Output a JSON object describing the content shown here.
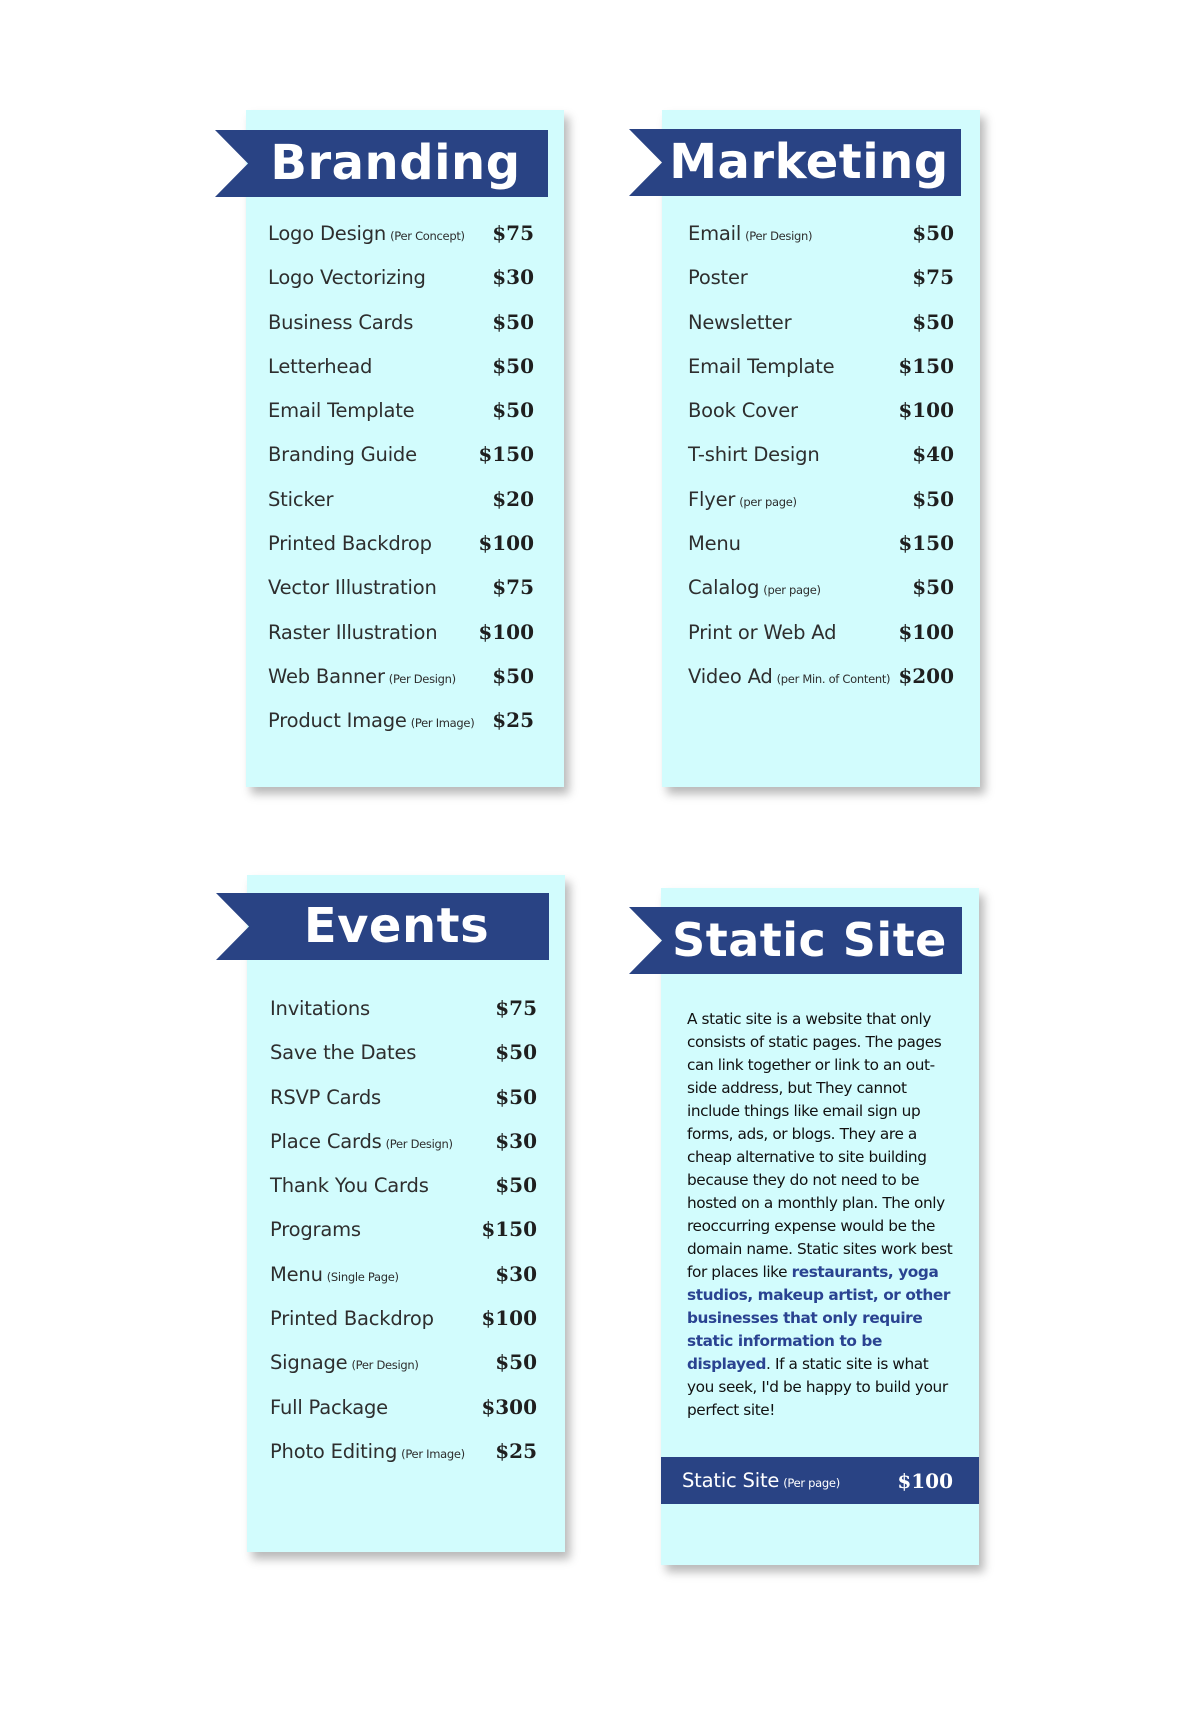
{
  "branding": {
    "title": "Branding",
    "items": [
      {
        "name": "Logo Design",
        "note": "(Per Concept)",
        "price": "$75"
      },
      {
        "name": "Logo Vectorizing",
        "note": "",
        "price": "$30"
      },
      {
        "name": "Business Cards",
        "note": "",
        "price": "$50"
      },
      {
        "name": "Letterhead",
        "note": "",
        "price": "$50"
      },
      {
        "name": "Email Template",
        "note": "",
        "price": "$50"
      },
      {
        "name": "Branding Guide",
        "note": "",
        "price": "$150"
      },
      {
        "name": "Sticker",
        "note": "",
        "price": "$20"
      },
      {
        "name": "Printed Backdrop",
        "note": "",
        "price": "$100"
      },
      {
        "name": "Vector Illustration",
        "note": "",
        "price": "$75"
      },
      {
        "name": "Raster Illustration",
        "note": "",
        "price": "$100"
      },
      {
        "name": "Web Banner",
        "note": "(Per Design)",
        "price": "$50"
      },
      {
        "name": "Product Image",
        "note": "(Per Image)",
        "price": "$25"
      }
    ]
  },
  "marketing": {
    "title": "Marketing",
    "items": [
      {
        "name": "Email",
        "note": "(Per Design)",
        "price": "$50"
      },
      {
        "name": "Poster",
        "note": "",
        "price": "$75"
      },
      {
        "name": "Newsletter",
        "note": "",
        "price": "$50"
      },
      {
        "name": "Email Template",
        "note": "",
        "price": "$150"
      },
      {
        "name": "Book Cover",
        "note": "",
        "price": "$100"
      },
      {
        "name": "T-shirt Design",
        "note": "",
        "price": "$40"
      },
      {
        "name": "Flyer",
        "note": "(per page)",
        "price": "$50"
      },
      {
        "name": "Menu",
        "note": "",
        "price": "$150"
      },
      {
        "name": "Calalog",
        "note": "(per page)",
        "price": "$50"
      },
      {
        "name": "Print or Web Ad",
        "note": "",
        "price": "$100"
      },
      {
        "name": "Video Ad",
        "note": "(per Min. of Content)",
        "price": "$200"
      }
    ]
  },
  "events": {
    "title": "Events",
    "items": [
      {
        "name": "Invitations",
        "note": "",
        "price": "$75"
      },
      {
        "name": "Save the Dates",
        "note": "",
        "price": "$50"
      },
      {
        "name": "RSVP Cards",
        "note": "",
        "price": "$50"
      },
      {
        "name": "Place Cards",
        "note": "(Per Design)",
        "price": "$30"
      },
      {
        "name": "Thank You Cards",
        "note": "",
        "price": "$50"
      },
      {
        "name": "Programs",
        "note": "",
        "price": "$150"
      },
      {
        "name": "Menu",
        "note": "(Single Page)",
        "price": "$30"
      },
      {
        "name": "Printed Backdrop",
        "note": "",
        "price": "$100"
      },
      {
        "name": "Signage",
        "note": "(Per Design)",
        "price": "$50"
      },
      {
        "name": "Full Package",
        "note": "",
        "price": "$300"
      },
      {
        "name": "Photo Editing",
        "note": "(Per Image)",
        "price": "$25"
      }
    ]
  },
  "static_site": {
    "title": "Static Site",
    "description_part1": "A static site is a website that only consists of static pages. The pages can link together or link to an out-side address, but They cannot include things like email sign up forms, ads, or blogs. They are a cheap alternative to site building because they do not need to be hosted on a monthly plan. The only reoccurring expense would be the domain name. Static sites work best for places like ",
    "description_highlight": "restaurants, yoga studios, makeup artist, or other businesses that only require static information to be displayed",
    "description_part2": ". If a static site is what you seek, I'd be happy to build your perfect site!",
    "price_item": {
      "name": "Static Site",
      "note": "(Per page)",
      "price": "$100"
    }
  }
}
